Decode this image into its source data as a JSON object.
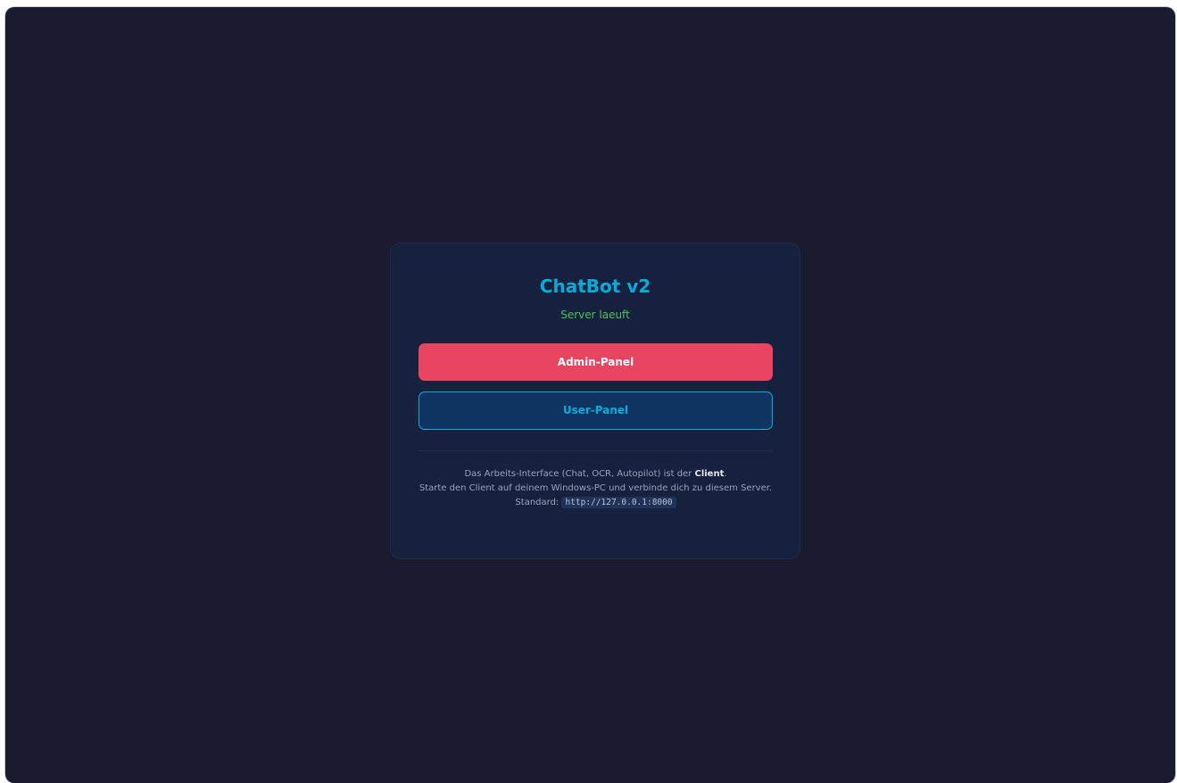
{
  "card": {
    "title": "ChatBot v2",
    "status": "Server laeuft",
    "admin_button": "Admin-Panel",
    "user_button": "User-Panel",
    "info": {
      "line1_prefix": "Das Arbeits-Interface (Chat, OCR, Autopilot) ist der ",
      "line1_bold": "Client",
      "line1_suffix": ".",
      "line2": "Starte den Client auf deinem Windows-PC und verbinde dich zu diesem Server.",
      "default_label": "Standard: ",
      "default_url": "http://127.0.0.1:8000"
    }
  },
  "colors": {
    "background": "#1a1b2e",
    "card": "#16213e",
    "accent": "#00aedb",
    "admin": "#e94560",
    "status": "#4ac25a"
  }
}
